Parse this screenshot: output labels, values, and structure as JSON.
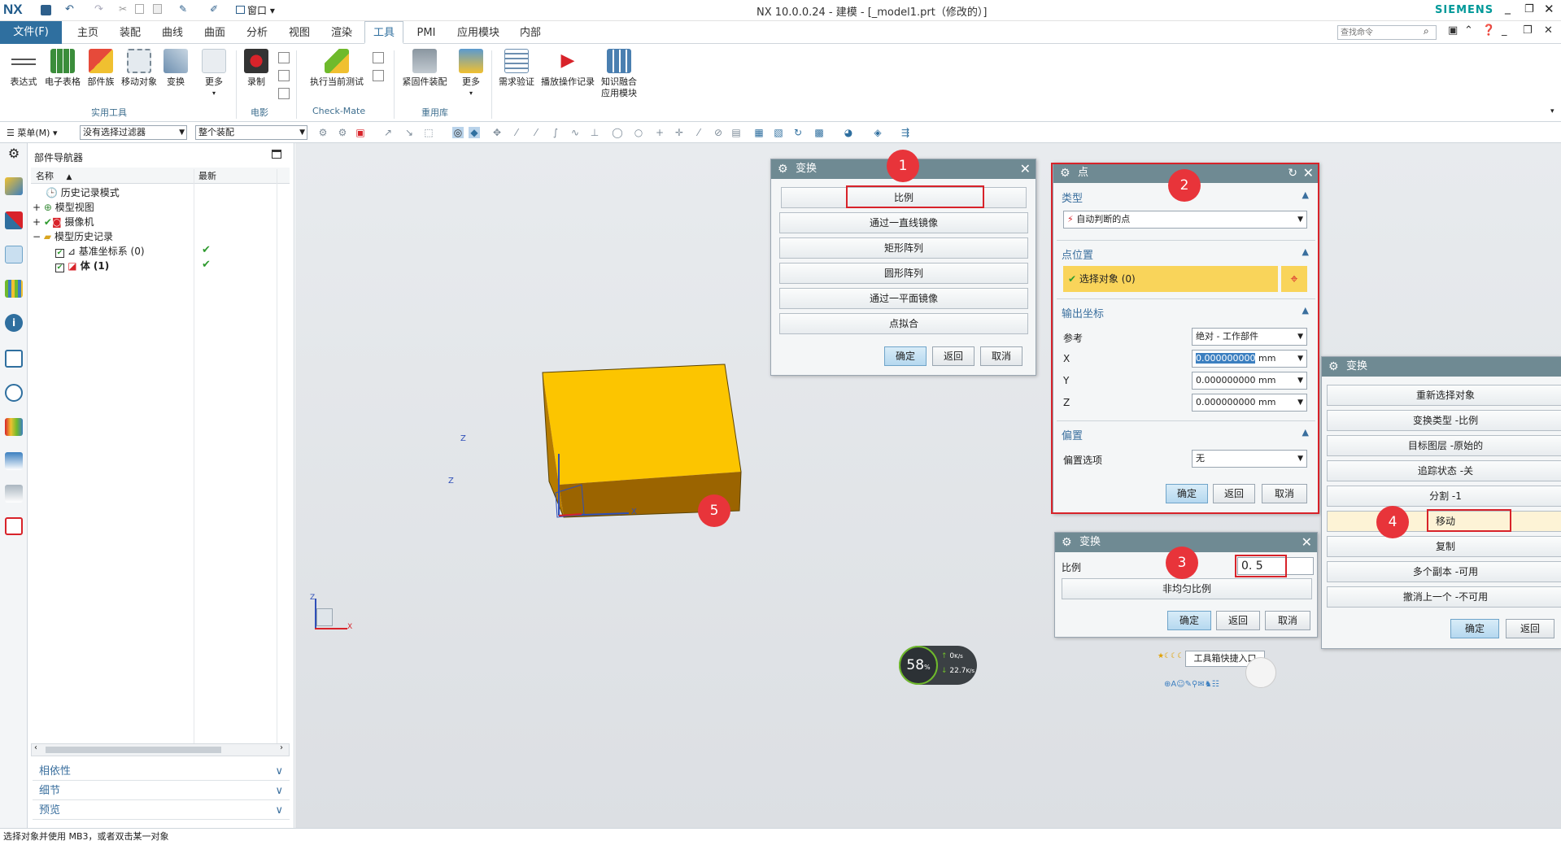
{
  "title_bar": {
    "logo": "NX",
    "window_title": "NX 10.0.0.24 - 建模 - [_model1.prt（修改的）]",
    "brand": "SIEMENS",
    "window_menu": "窗口"
  },
  "menu_bar": {
    "items": [
      "文件(F)",
      "主页",
      "装配",
      "曲线",
      "曲面",
      "分析",
      "视图",
      "渲染",
      "工具",
      "PMI",
      "应用模块",
      "内部"
    ],
    "active": "工具",
    "search_placeholder": "查找命令"
  },
  "ribbon": {
    "buttons": [
      {
        "label": "表达式",
        "icon": "expression-icon"
      },
      {
        "label": "电子表格",
        "icon": "spreadsheet-icon"
      },
      {
        "label": "部件族",
        "icon": "part-family-icon"
      },
      {
        "label": "移动对象",
        "icon": "move-object-icon"
      },
      {
        "label": "变换",
        "icon": "transform-icon"
      },
      {
        "label": "更多",
        "icon": "more-icon"
      },
      {
        "label": "录制",
        "icon": "record-icon"
      },
      {
        "label": "执行当前测试",
        "icon": "checkmate-run-icon"
      },
      {
        "label": "紧固件装配",
        "icon": "fastener-icon"
      },
      {
        "label": "更多",
        "icon": "more-icon"
      },
      {
        "label": "需求验证",
        "icon": "requirement-icon"
      },
      {
        "label": "播放操作记录",
        "icon": "play-journal-icon"
      },
      {
        "label": "知识融合",
        "label2": "应用模块",
        "icon": "knowledge-fusion-icon"
      }
    ],
    "groups": [
      "实用工具",
      "电影",
      "Check-Mate",
      "重用库"
    ]
  },
  "toolbar2": {
    "menu_label": "菜单(M)",
    "filter": "没有选择过滤器",
    "scope": "整个装配"
  },
  "navigator": {
    "title": "部件导航器",
    "col_name": "名称",
    "col_latest": "最新",
    "rows": [
      {
        "label": "历史记录模式",
        "latest": ""
      },
      {
        "label": "模型视图",
        "latest": ""
      },
      {
        "label": "摄像机",
        "latest": ""
      },
      {
        "label": "模型历史记录",
        "latest": ""
      },
      {
        "label": "基准坐标系 (0)",
        "latest": "✔"
      },
      {
        "label": "体 (1)",
        "latest": "✔"
      }
    ],
    "sections": [
      "相依性",
      "细节",
      "预览"
    ]
  },
  "dialog_transform1": {
    "title": "变换",
    "buttons": [
      "比例",
      "通过一直线镜像",
      "矩形阵列",
      "圆形阵列",
      "通过一平面镜像",
      "点拟合"
    ],
    "ok": "确定",
    "back": "返回",
    "cancel": "取消"
  },
  "dialog_point": {
    "title": "点",
    "section_type": "类型",
    "type_value": "自动判断的点",
    "section_location": "点位置",
    "select_object": "选择对象 (0)",
    "section_output": "输出坐标",
    "reference_label": "参考",
    "reference_value": "绝对 - 工作部件",
    "x_label": "X",
    "x_value": "0.000000000",
    "y_label": "Y",
    "y_value": "0.000000000",
    "z_label": "Z",
    "z_value": "0.000000000",
    "unit": "mm",
    "section_offset": "偏置",
    "offset_label": "偏置选项",
    "offset_value": "无",
    "ok": "确定",
    "back": "返回",
    "cancel": "取消"
  },
  "dialog_scale": {
    "title": "变换",
    "scale_label": "比例",
    "scale_value": "0. 5",
    "nonuniform": "非均匀比例",
    "ok": "确定",
    "back": "返回",
    "cancel": "取消"
  },
  "dialog_transform2": {
    "title": "变换",
    "buttons": [
      "重新选择对象",
      "变换类型 -比例",
      "目标图层 -原始的",
      "追踪状态 -关",
      "分割 -1",
      "移动",
      "复制",
      "多个副本 -可用",
      "撤消上一个 -不可用"
    ],
    "ok": "确定",
    "back": "返回"
  },
  "badges": [
    "1",
    "2",
    "3",
    "4",
    "5"
  ],
  "triad": {
    "x": "X",
    "y": "Y",
    "z": "Z"
  },
  "net_widget": {
    "percent": "58",
    "pct_sign": "%",
    "up": "0",
    "up_unit": "K/s",
    "down": "22.7",
    "down_unit": "K/s"
  },
  "corner_popup": "工具箱快捷入口",
  "statusbar": {
    "text": "选择对象并使用 MB3，或者双击某一对象"
  },
  "colors": {
    "accent": "#3a6f9e",
    "dialog_header": "#6f8a93",
    "box": "#f5c400",
    "badge": "#e8343a"
  }
}
